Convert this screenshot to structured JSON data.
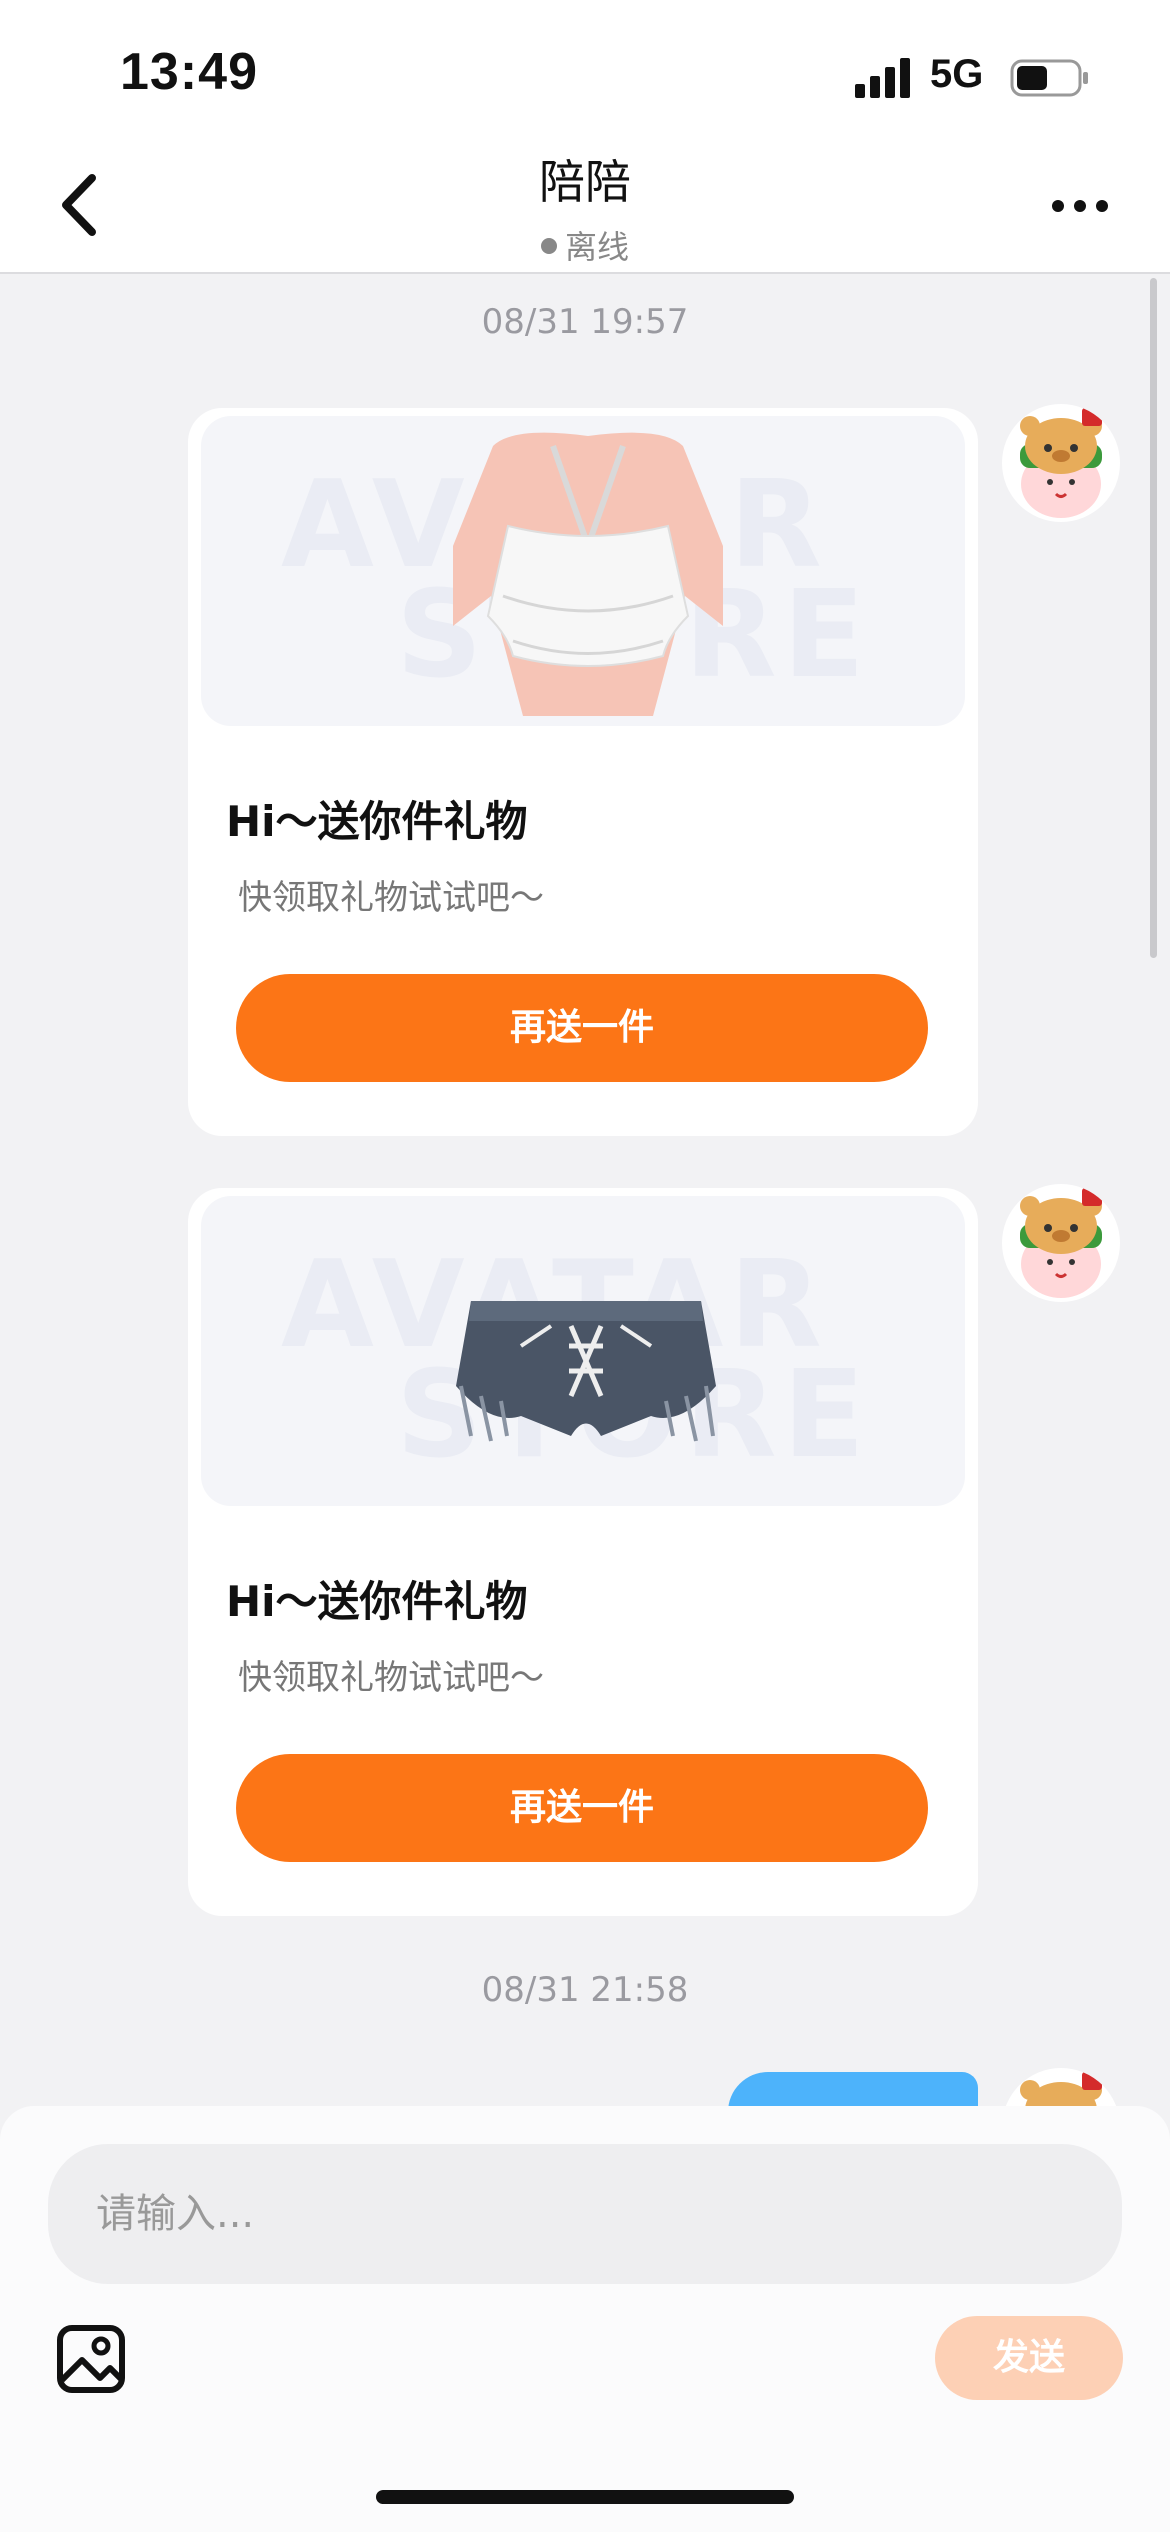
{
  "status_bar": {
    "time": "13:49",
    "network": "5G"
  },
  "header": {
    "title": "陪陪",
    "status": "离线",
    "back_icon": "chevron-left-icon",
    "more_icon": "more-dots-icon"
  },
  "messages": [
    {
      "timestamp": "08/31 19:57"
    },
    {
      "card_title": "Hi～送你件礼物",
      "card_subtitle": "快领取礼物试试吧～",
      "button": "再送一件",
      "watermark": [
        "AVATAR",
        "STORE"
      ],
      "item": "white ruffle halter top"
    },
    {
      "card_title": "Hi～送你件礼物",
      "card_subtitle": "快领取礼物试试吧～",
      "button": "再送一件",
      "watermark": [
        "AVATAR",
        "STORE"
      ],
      "item": "denim fringe shorts"
    },
    {
      "timestamp": "08/31 21:58"
    }
  ],
  "composer": {
    "placeholder": "请输入...",
    "send_label": "发送",
    "image_icon": "image-icon"
  },
  "colors": {
    "accent": "#fc7516",
    "send_disabled": "#fdd0b5",
    "bubble": "#4db3fb",
    "background": "#f2f2f4"
  }
}
